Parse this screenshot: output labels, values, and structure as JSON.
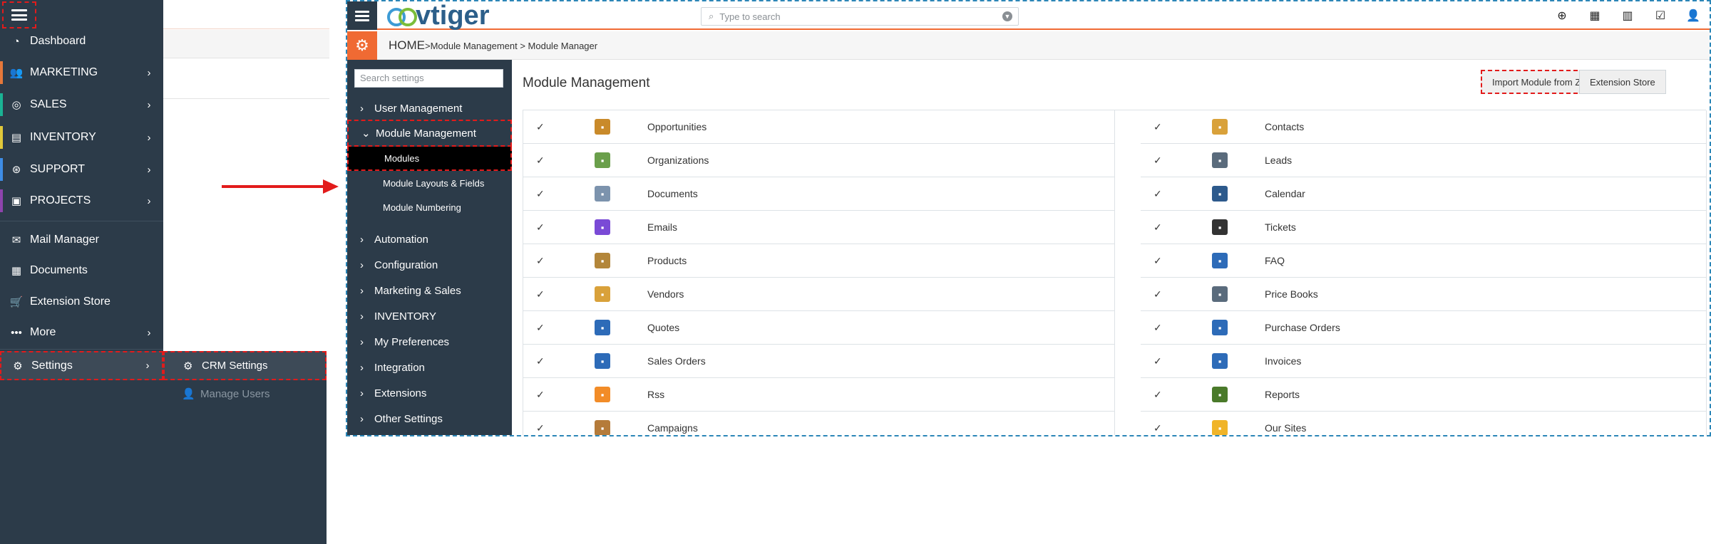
{
  "left_menu": {
    "items": [
      {
        "label": "Dashboard",
        "icon": "dashboard-icon",
        "color": ""
      },
      {
        "label": "MARKETING",
        "icon": "users-icon",
        "color": "#e5783a"
      },
      {
        "label": "SALES",
        "icon": "target-icon",
        "color": "#1ab394"
      },
      {
        "label": "INVENTORY",
        "icon": "archive-icon",
        "color": "#e0c83a"
      },
      {
        "label": "SUPPORT",
        "icon": "lifebuoy-icon",
        "color": "#3e8de6"
      },
      {
        "label": "PROJECTS",
        "icon": "briefcase-icon",
        "color": "#8e44ad"
      },
      {
        "label": "Mail Manager",
        "icon": "mail-icon",
        "color": ""
      },
      {
        "label": "Documents",
        "icon": "document-icon",
        "color": ""
      },
      {
        "label": "Extension Store",
        "icon": "cart-icon",
        "color": ""
      },
      {
        "label": "More",
        "icon": "ellipsis-icon",
        "color": ""
      },
      {
        "label": "Settings",
        "icon": "gear-icon",
        "color": ""
      }
    ],
    "submenu": {
      "crm_settings": "CRM Settings",
      "manage_users": "Manage Users"
    }
  },
  "crm": {
    "logo_text": "vtiger",
    "search_placeholder": "Type to search",
    "breadcrumb": {
      "home": "HOME",
      "path": ">Module Management > Module Manager"
    },
    "sidebar": {
      "search_placeholder": "Search settings",
      "sections": {
        "user_management": "User Management",
        "module_management": "Module Management",
        "modules": "Modules",
        "module_layouts": "Module Layouts & Fields",
        "module_numbering": "Module Numbering",
        "automation": "Automation",
        "configuration": "Configuration",
        "marketing_sales": "Marketing & Sales",
        "inventory": "INVENTORY",
        "my_preferences": "My Preferences",
        "integration": "Integration",
        "extensions": "Extensions",
        "other_settings": "Other Settings"
      }
    },
    "main": {
      "title": "Module Management",
      "import_button": "Import Module from Zip",
      "store_button": "Extension Store",
      "left_modules": [
        {
          "name": "Opportunities",
          "icon": "money-bag-icon",
          "color": "#c98a2a"
        },
        {
          "name": "Organizations",
          "icon": "map-icon",
          "color": "#6a9f4b"
        },
        {
          "name": "Documents",
          "icon": "calendar-doc-icon",
          "color": "#7c93ad"
        },
        {
          "name": "Emails",
          "icon": "puzzle-icon",
          "color": "#7a4ad6"
        },
        {
          "name": "Products",
          "icon": "box-icon",
          "color": "#b3863a"
        },
        {
          "name": "Vendors",
          "icon": "truck-icon",
          "color": "#d9a13a"
        },
        {
          "name": "Quotes",
          "icon": "quote-doc-icon",
          "color": "#2d6bb8"
        },
        {
          "name": "Sales Orders",
          "icon": "sales-order-icon",
          "color": "#2d6bb8"
        },
        {
          "name": "Rss",
          "icon": "rss-icon",
          "color": "#f28c28"
        },
        {
          "name": "Campaigns",
          "icon": "megaphone-icon",
          "color": "#b57b3a"
        }
      ],
      "right_modules": [
        {
          "name": "Contacts",
          "icon": "person-icon",
          "color": "#d9a13a"
        },
        {
          "name": "Leads",
          "icon": "id-card-icon",
          "color": "#5a6b7c"
        },
        {
          "name": "Calendar",
          "icon": "calendar-icon",
          "color": "#2d5a8c"
        },
        {
          "name": "Tickets",
          "icon": "headset-icon",
          "color": "#333333"
        },
        {
          "name": "FAQ",
          "icon": "help-icon",
          "color": "#2d6bb8"
        },
        {
          "name": "Price Books",
          "icon": "books-icon",
          "color": "#5a6b7c"
        },
        {
          "name": "Purchase Orders",
          "icon": "purchase-order-icon",
          "color": "#2d6bb8"
        },
        {
          "name": "Invoices",
          "icon": "invoice-icon",
          "color": "#2d6bb8"
        },
        {
          "name": "Reports",
          "icon": "reports-icon",
          "color": "#4a7a2a"
        },
        {
          "name": "Our Sites",
          "icon": "star-icon",
          "color": "#f0b429"
        }
      ]
    }
  }
}
